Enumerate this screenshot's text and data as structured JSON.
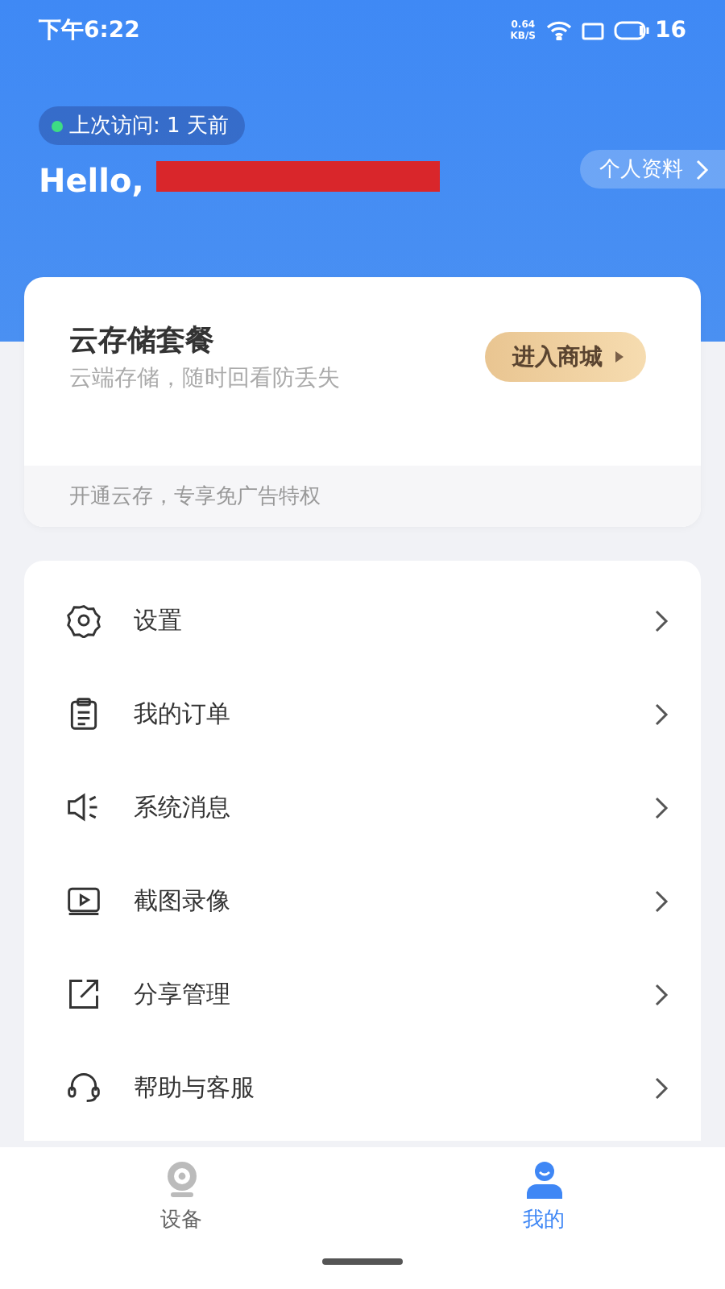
{
  "status_bar": {
    "time": "下午6:22",
    "speed": "0.64",
    "speed_unit": "KB/S",
    "battery": "16"
  },
  "header": {
    "last_visit": "上次访问: 1 天前",
    "online": true,
    "greeting": "Hello,",
    "profile_link": "个人资料"
  },
  "storage_card": {
    "title": "云存储套餐",
    "subtitle": "云端存储，随时回看防丢失",
    "button": "进入商城",
    "footer": "开通云存，专享免广告特权"
  },
  "menu": [
    {
      "kind": "gear",
      "label": "设置"
    },
    {
      "kind": "clipboard",
      "label": "我的订单"
    },
    {
      "kind": "speaker",
      "label": "系统消息"
    },
    {
      "kind": "video",
      "label": "截图录像"
    },
    {
      "kind": "share",
      "label": "分享管理"
    },
    {
      "kind": "headset",
      "label": "帮助与客服"
    }
  ],
  "tab_bar": [
    {
      "kind": "camera",
      "label": "设备",
      "selected": false
    },
    {
      "kind": "person",
      "label": "我的",
      "selected": true
    }
  ]
}
